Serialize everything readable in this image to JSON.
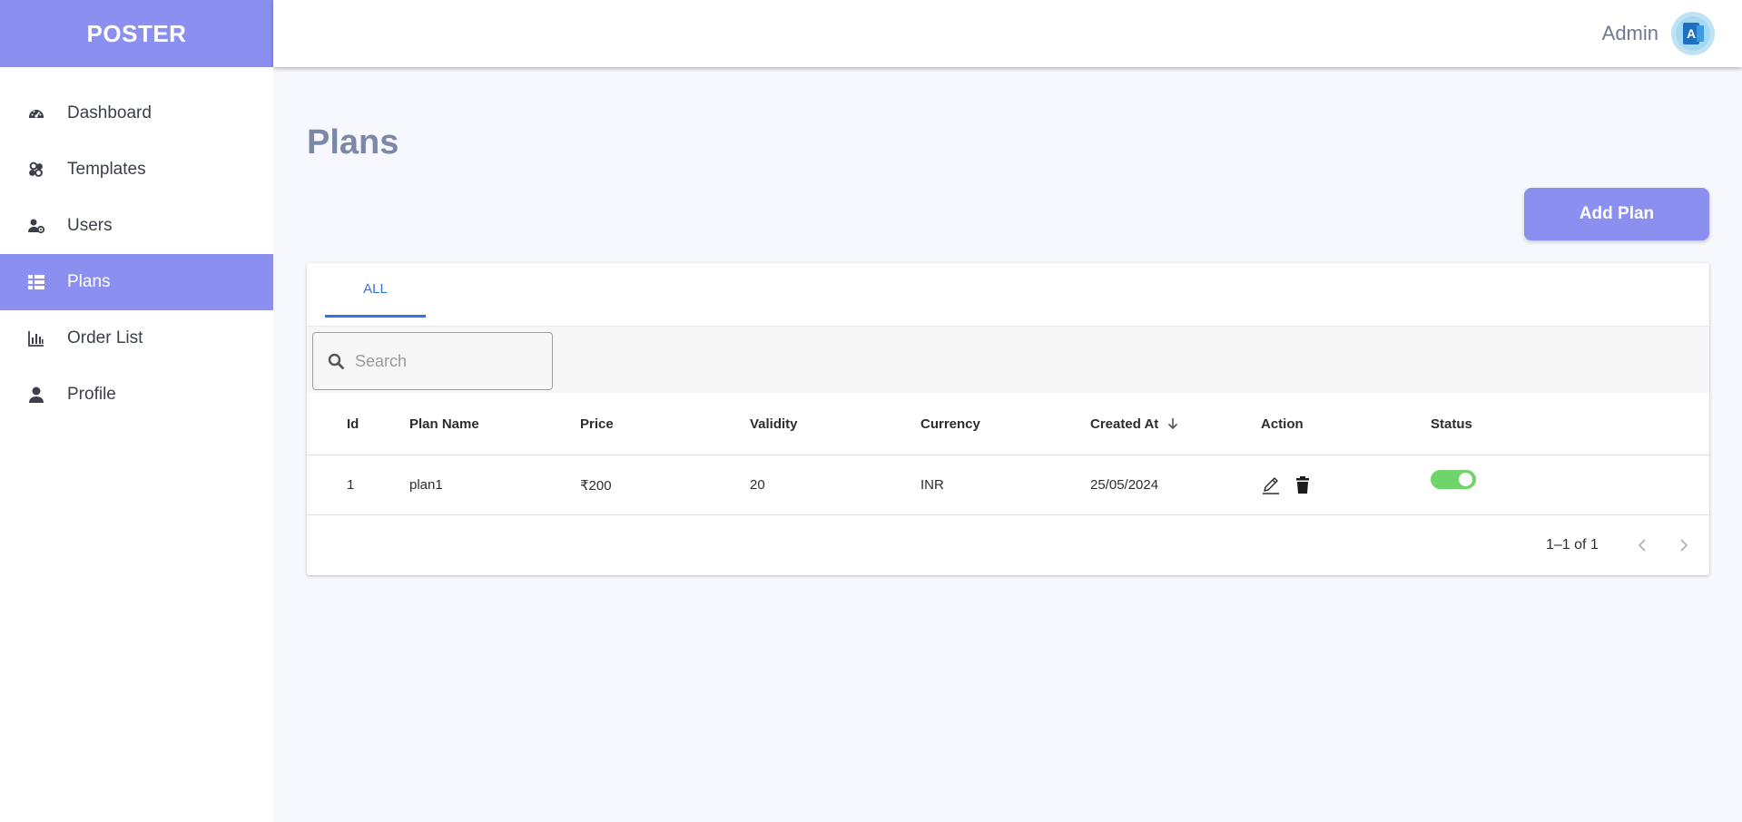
{
  "brand": {
    "name": "POSTER"
  },
  "header": {
    "user_name": "Admin",
    "avatar_letter": "A"
  },
  "sidebar": {
    "items": [
      {
        "label": "Dashboard",
        "icon": "dashboard-icon"
      },
      {
        "label": "Templates",
        "icon": "templates-icon"
      },
      {
        "label": "Users",
        "icon": "users-icon"
      },
      {
        "label": "Plans",
        "icon": "plans-icon",
        "active": true
      },
      {
        "label": "Order List",
        "icon": "chart-icon"
      },
      {
        "label": "Profile",
        "icon": "profile-icon"
      }
    ]
  },
  "main": {
    "title": "Plans",
    "add_button": "Add Plan",
    "tabs": [
      {
        "label": "ALL",
        "active": true
      }
    ],
    "search": {
      "placeholder": "Search",
      "value": ""
    },
    "table": {
      "columns": [
        "Id",
        "Plan Name",
        "Price",
        "Validity",
        "Currency",
        "Created At",
        "Action",
        "Status"
      ],
      "sort_column": "Created At",
      "sort_direction": "desc",
      "rows": [
        {
          "id": "1",
          "plan_name": "plan1",
          "price": "₹200",
          "validity": "20",
          "currency": "INR",
          "created_at": "25/05/2024",
          "status": true
        }
      ]
    },
    "pagination": {
      "label": "1–1 of 1"
    }
  },
  "colors": {
    "accent": "#8a8ff0",
    "tab_active": "#2f75d6",
    "toggle_on": "#6fd46a",
    "title": "#7b88a8",
    "background": "#f6f8fd"
  }
}
